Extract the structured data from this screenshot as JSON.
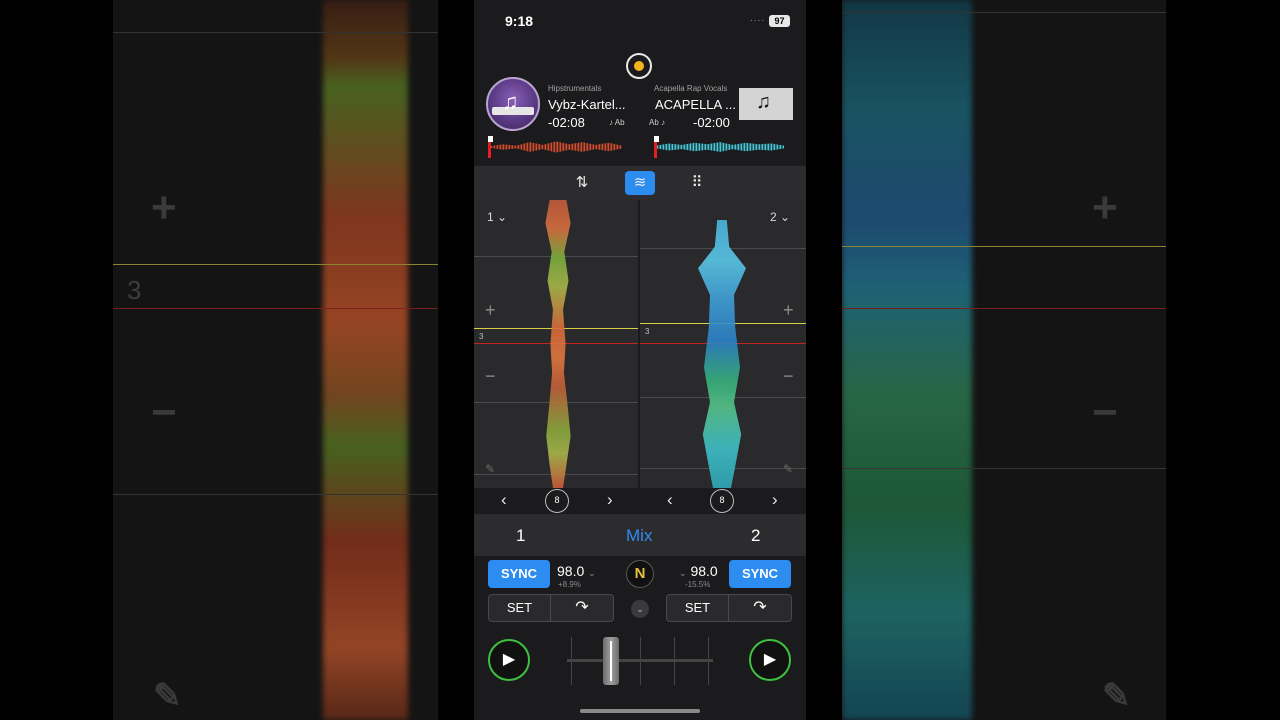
{
  "status_bar": {
    "time": "9:18",
    "signal": "....",
    "battery": "97"
  },
  "deck_a": {
    "number": "1",
    "artist": "Hipstrumentals",
    "title": "Vybz-Kartel...",
    "remaining": "-02:08",
    "key": "♪ Ab",
    "bpm": "98.0",
    "pitch": "+8.9%",
    "sync_label": "SYNC",
    "set_label": "SET",
    "loop_beats": "8",
    "beat_marker": "3",
    "waveform_color": "#d8603b"
  },
  "deck_b": {
    "number": "2",
    "artist": "Acapella Rap Vocals",
    "title": "ACAPELLA ...",
    "remaining": "-02:00",
    "key": "Ab ♪",
    "bpm": "98.0",
    "pitch": "-15.5%",
    "sync_label": "SYNC",
    "set_label": "SET",
    "loop_beats": "8",
    "beat_marker": "3",
    "waveform_color": "#2fb8d9"
  },
  "mix_bar": {
    "left": "1",
    "center": "Mix",
    "right": "2"
  },
  "symbols": {
    "plus": "+",
    "minus": "−",
    "prev": "‹",
    "next": "›",
    "play": "▶",
    "n_logo": "N",
    "chevron": "⌄",
    "pencil": "✎",
    "caret": "⌄"
  },
  "side_views": {
    "left_beat_marker": "3"
  },
  "colors": {
    "accent": "#2d8cf0",
    "play_ring": "#3ec13e",
    "record_dot": "#f3b41c",
    "cue_line": "#d8cf45",
    "playhead": "#c0281f"
  },
  "crossfader": {
    "position": 0.3
  }
}
